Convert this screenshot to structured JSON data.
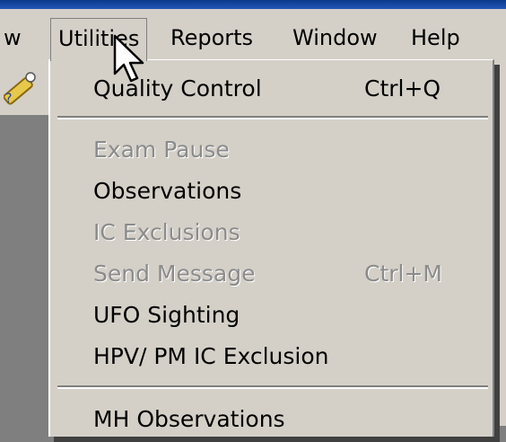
{
  "menubar": {
    "items": [
      {
        "label": "w"
      },
      {
        "label": "Utilities"
      },
      {
        "label": "Reports"
      },
      {
        "label": "Window"
      },
      {
        "label": "Help"
      }
    ]
  },
  "toolbar": {
    "icon": "help-wand-icon"
  },
  "dropdown": {
    "items": [
      {
        "label": "Quality Control",
        "shortcut": "Ctrl+Q",
        "enabled": true
      },
      {
        "label": "Exam Pause",
        "enabled": false
      },
      {
        "label": "Observations",
        "enabled": true
      },
      {
        "label": "IC Exclusions",
        "enabled": false
      },
      {
        "label": "Send Message",
        "shortcut": "Ctrl+M",
        "enabled": false
      },
      {
        "label": "UFO Sighting",
        "enabled": true
      },
      {
        "label": "HPV/ PM IC Exclusion",
        "enabled": true
      },
      {
        "label": "MH Observations",
        "enabled": true
      }
    ]
  },
  "colors": {
    "menu_bg": "#d4d0c8",
    "disabled_text": "#8b8b8b",
    "desktop": "#7f7f7f"
  }
}
